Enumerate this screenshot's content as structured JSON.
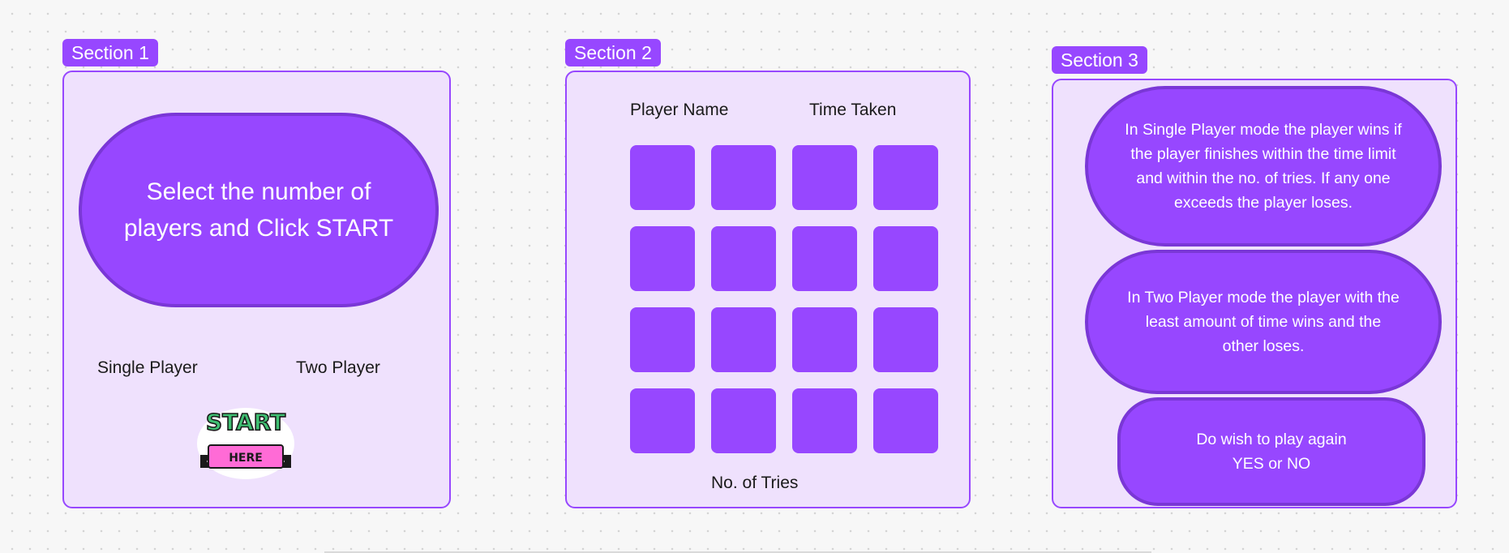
{
  "section1": {
    "tag": "Section 1",
    "prompt_line1": "Select the number of",
    "prompt_line2": "players and Click START",
    "option_single": "Single Player",
    "option_two": "Two Player",
    "start_sticker": {
      "word": "START",
      "ribbon": "HERE"
    }
  },
  "section2": {
    "tag": "Section 2",
    "player_name_label": "Player Name",
    "time_taken_label": "Time Taken",
    "tries_label": "No. of Tries",
    "tile_rows": 4,
    "tile_cols": 4
  },
  "section3": {
    "tag": "Section 3",
    "single_rule": [
      "In Single Player mode the player wins if",
      "the player finishes within the time limit",
      "and within the no. of tries. If any one",
      "exceeds the player loses."
    ],
    "two_rule": [
      "In Two Player mode the player with the",
      "least amount of time wins and the",
      "other loses."
    ],
    "replay": [
      "Do wish to play again",
      "YES or NO"
    ]
  },
  "colors": {
    "accent": "#9747ff",
    "accent_dark": "#7a37d6",
    "frame_fill": "#efe1fd",
    "sticker_green": "#3fbf72",
    "sticker_pink": "#ff6bd6"
  }
}
